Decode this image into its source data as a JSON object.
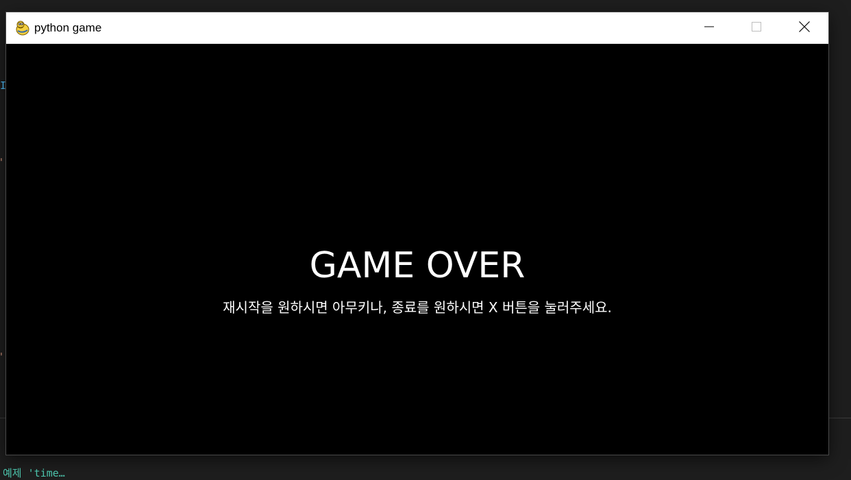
{
  "background": {
    "fragment_1": "I",
    "fragment_2": "\"",
    "fragment_3": "\"",
    "terminal_text": "예제 'time…"
  },
  "window": {
    "title": "python game",
    "app_icon": "pygame-snake-icon",
    "controls": {
      "minimize": "minimize-icon",
      "maximize": "maximize-icon",
      "close": "close-icon"
    }
  },
  "game": {
    "title": "GAME OVER",
    "message": "재시작을 원하시면 아무키나, 종료를 원하시면 X 버튼을 눌러주세요.",
    "text_color": "#ffffff",
    "background_color": "#000000"
  }
}
